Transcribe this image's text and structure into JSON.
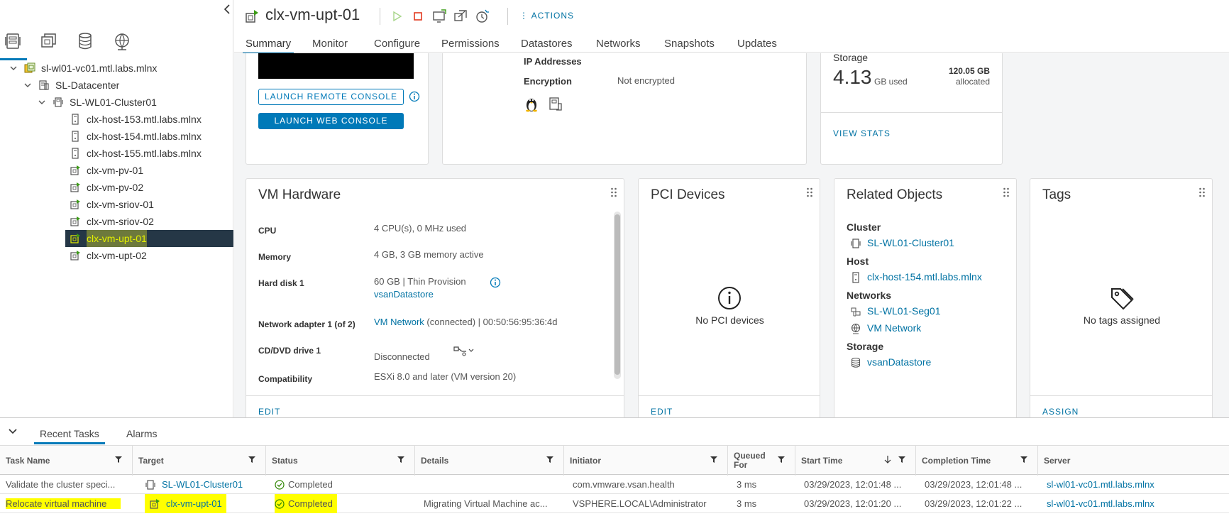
{
  "navigator": {
    "tree": [
      {
        "label": "sl-wl01-vc01.mtl.labs.mlnx",
        "type": "vcenter"
      },
      {
        "label": "SL-Datacenter",
        "type": "datacenter"
      },
      {
        "label": "SL-WL01-Cluster01",
        "type": "cluster"
      },
      {
        "label": "clx-host-153.mtl.labs.mlnx",
        "type": "host"
      },
      {
        "label": "clx-host-154.mtl.labs.mlnx",
        "type": "host"
      },
      {
        "label": "clx-host-155.mtl.labs.mlnx",
        "type": "host"
      },
      {
        "label": "clx-vm-pv-01",
        "type": "vm"
      },
      {
        "label": "clx-vm-pv-02",
        "type": "vm"
      },
      {
        "label": "clx-vm-sriov-01",
        "type": "vm"
      },
      {
        "label": "clx-vm-sriov-02",
        "type": "vm"
      },
      {
        "label": "clx-vm-upt-01",
        "type": "vm",
        "selected": true
      },
      {
        "label": "clx-vm-upt-02",
        "type": "vm"
      }
    ]
  },
  "header": {
    "title": "clx-vm-upt-01",
    "actions_label": "ACTIONS",
    "tabs": [
      "Summary",
      "Monitor",
      "Configure",
      "Permissions",
      "Datastores",
      "Networks",
      "Snapshots",
      "Updates"
    ],
    "active_tab": "Summary"
  },
  "console_card": {
    "launch_remote": "LAUNCH REMOTE CONSOLE",
    "launch_web": "LAUNCH WEB CONSOLE"
  },
  "guest_card": {
    "ip_label": "IP Addresses",
    "encryption_label": "Encryption",
    "encryption_value": "Not encrypted"
  },
  "storage_card": {
    "title": "Storage",
    "used_value": "4.13",
    "used_unit": "GB used",
    "allocated_value": "120.05 GB",
    "allocated_label": "allocated",
    "view_stats": "VIEW STATS"
  },
  "vm_hardware": {
    "title": "VM Hardware",
    "cpu_label": "CPU",
    "cpu_value": "4 CPU(s), 0 MHz used",
    "memory_label": "Memory",
    "memory_value": "4 GB, 3 GB memory active",
    "disk_label": "Hard disk 1",
    "disk_value": "60 GB | Thin Provision",
    "disk_datastore": "vsanDatastore",
    "net_label": "Network adapter 1 (of 2)",
    "net_link": "VM Network",
    "net_value": "(connected) | 00:50:56:95:36:4d",
    "cd_label": "CD/DVD drive 1",
    "cd_value": "Disconnected",
    "compat_label": "Compatibility",
    "compat_value": "ESXi 8.0 and later (VM version 20)",
    "edit": "EDIT"
  },
  "pci_devices": {
    "title": "PCI Devices",
    "empty": "No PCI devices",
    "edit": "EDIT"
  },
  "related_objects": {
    "title": "Related Objects",
    "cluster_label": "Cluster",
    "cluster_value": "SL-WL01-Cluster01",
    "host_label": "Host",
    "host_value": "clx-host-154.mtl.labs.mlnx",
    "networks_label": "Networks",
    "network1": "SL-WL01-Seg01",
    "network2": "VM Network",
    "storage_label": "Storage",
    "storage_value": "vsanDatastore"
  },
  "tags": {
    "title": "Tags",
    "empty": "No tags assigned",
    "assign": "ASSIGN"
  },
  "bottom": {
    "tabs": [
      "Recent Tasks",
      "Alarms"
    ],
    "columns": [
      "Task Name",
      "Target",
      "Status",
      "Details",
      "Initiator",
      "Queued For",
      "Start Time",
      "Completion Time",
      "Server"
    ],
    "rows": [
      {
        "task": "Validate the cluster speci...",
        "target": "SL-WL01-Cluster01",
        "status": "Completed",
        "details": "",
        "initiator": "com.vmware.vsan.health",
        "queued": "3 ms",
        "start": "03/29/2023, 12:01:48 ...",
        "completion": "03/29/2023, 12:01:48 ...",
        "server": "sl-wl01-vc01.mtl.labs.mlnx"
      },
      {
        "task": "Relocate virtual machine",
        "target": "clx-vm-upt-01",
        "status": "Completed",
        "details": "Migrating Virtual Machine ac...",
        "initiator": "VSPHERE.LOCAL\\Administrator",
        "queued": "3 ms",
        "start": "03/29/2023, 12:01:20 ...",
        "completion": "03/29/2023, 12:01:22 ...",
        "server": "sl-wl01-vc01.mtl.labs.mlnx"
      }
    ]
  },
  "colors": {
    "accent": "#0079b8",
    "link": "#0072a3",
    "selected_bg": "#253746",
    "highlight": "#ffff00",
    "success": "#2e8500"
  }
}
